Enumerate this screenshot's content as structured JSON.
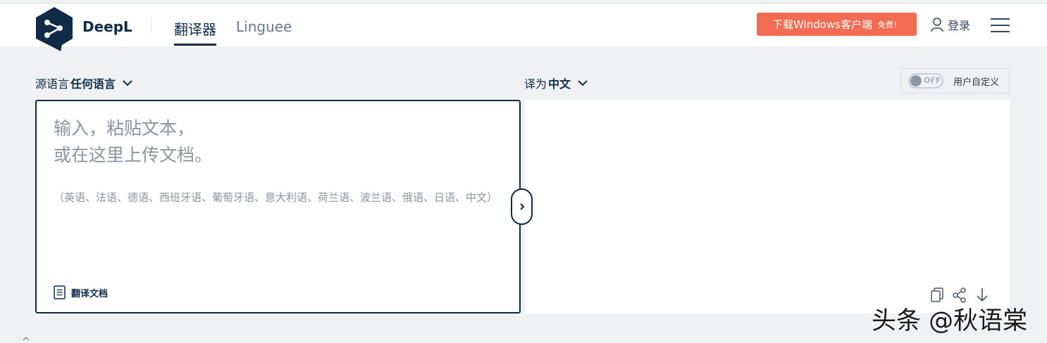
{
  "header": {
    "brand": "DeepL",
    "nav": {
      "translator_label": "翻译器",
      "linguee_label": "Linguee"
    },
    "download": {
      "label": "下载Windows客户端",
      "badge": "免费！"
    },
    "login_label": "登录"
  },
  "source": {
    "label_prefix": "源语言",
    "selected_language": "任何语言",
    "placeholder_line1": "输入，粘贴文本，",
    "placeholder_line2": "或在这里上传文档。",
    "supported_languages": "（英语、法语、德语、西班牙语、葡萄牙语、意大利语、荷兰语、波兰语、俄语、日语、中文）",
    "translate_document_label": "翻译文档"
  },
  "target": {
    "label_prefix": "译为",
    "selected_language": "中文"
  },
  "customization": {
    "toggle_state": "OFF",
    "label": "用户自定义"
  },
  "watermark": "头条 @秋语棠",
  "icons": {
    "logo": "deepl-logo-icon",
    "user": "user-icon",
    "menu": "hamburger-menu-icon",
    "document": "document-icon",
    "swap": "chevron-right-icon",
    "copy": "copy-icon",
    "share": "share-icon",
    "download": "download-icon"
  },
  "colors": {
    "brand_navy": "#0f2b46",
    "accent_orange": "#f26b52",
    "page_background": "#f0f1f3",
    "placeholder_gray": "#8e949b"
  }
}
